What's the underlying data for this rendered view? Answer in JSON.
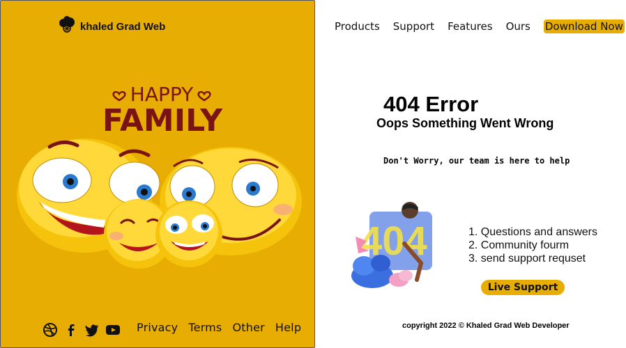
{
  "brand": {
    "name": "khaled Grad Web",
    "icon": "tree-logo-icon"
  },
  "hero": {
    "line1": "HAPPY",
    "line2": "FAMILY"
  },
  "social": [
    "dribbble-icon",
    "facebook-icon",
    "twitter-icon",
    "youtube-icon"
  ],
  "footer_links": [
    "Privacy",
    "Terms",
    "Other",
    "Help"
  ],
  "nav": {
    "items": [
      "Products",
      "Support",
      "Features",
      "Ours"
    ],
    "download_label": "Download Now"
  },
  "error": {
    "title": "404 Error",
    "subtitle": "Oops Something Went Wrong",
    "message": "Don't Worry, our team is here to help"
  },
  "art_label": "404",
  "help_items": [
    "Questions and answers",
    "Community fourm",
    "send support requset"
  ],
  "live_support_label": "Live Support",
  "copyright": "copyright 2022 © Khaled Grad Web Developer",
  "colors": {
    "accent": "#e8ad02",
    "hero_text": "#7a1414"
  }
}
